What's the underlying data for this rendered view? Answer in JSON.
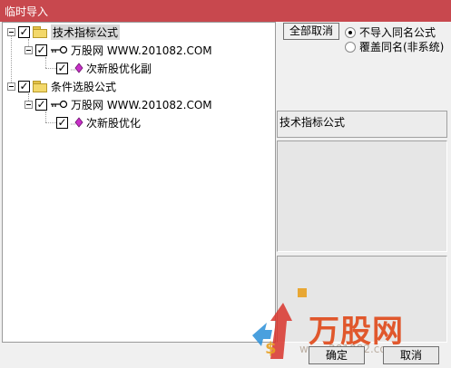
{
  "window": {
    "title": "临时导入"
  },
  "tree": {
    "groups": [
      {
        "label": "技术指标公式",
        "checked": true,
        "source": {
          "label": "万股网 WWW.201082.COM",
          "checked": true,
          "formula": {
            "label": "次新股优化副",
            "checked": true
          }
        }
      },
      {
        "label": "条件选股公式",
        "checked": true,
        "source": {
          "label": "万股网 WWW.201082.COM",
          "checked": true,
          "formula": {
            "label": "次新股优化",
            "checked": true
          }
        }
      }
    ]
  },
  "options": {
    "deselect_all_label": "全部取消",
    "radio_skip_label": "不导入同名公式",
    "radio_overwrite_label": "覆盖同名(非系统)",
    "selected": "skip"
  },
  "detail": {
    "type_label": "技术指标公式"
  },
  "buttons": {
    "ok_label": "确定",
    "cancel_label": "取消"
  },
  "watermark": {
    "brand": "万股网",
    "url": "www.201082.com"
  },
  "colors": {
    "titlebar": "#c8484e",
    "check_mark": "#000000"
  }
}
